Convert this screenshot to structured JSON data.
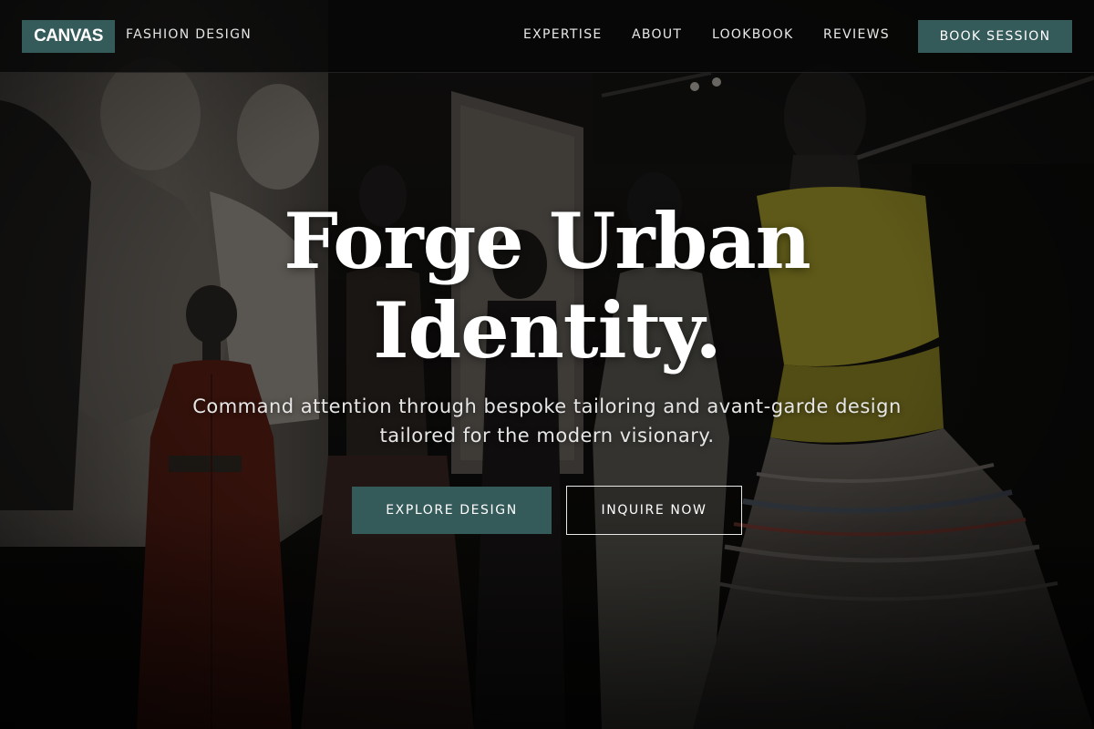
{
  "brand": {
    "logo_text": "CANVAS",
    "tagline": "FASHION DESIGN"
  },
  "nav": {
    "items": [
      {
        "label": "EXPERTISE"
      },
      {
        "label": "ABOUT"
      },
      {
        "label": "LOOKBOOK"
      },
      {
        "label": "REVIEWS"
      }
    ],
    "book_label": "BOOK SESSION"
  },
  "hero": {
    "headline_line1": "Forge Urban",
    "headline_line2": "Identity.",
    "subheadline": "Command attention through bespoke tailoring and avant-garde design tailored for the modern visionary.",
    "primary_cta": "EXPLORE DESIGN",
    "secondary_cta": "INQUIRE NOW"
  },
  "colors": {
    "accent": "#355a5a",
    "header_bg": "#060606",
    "text": "#ffffff"
  }
}
